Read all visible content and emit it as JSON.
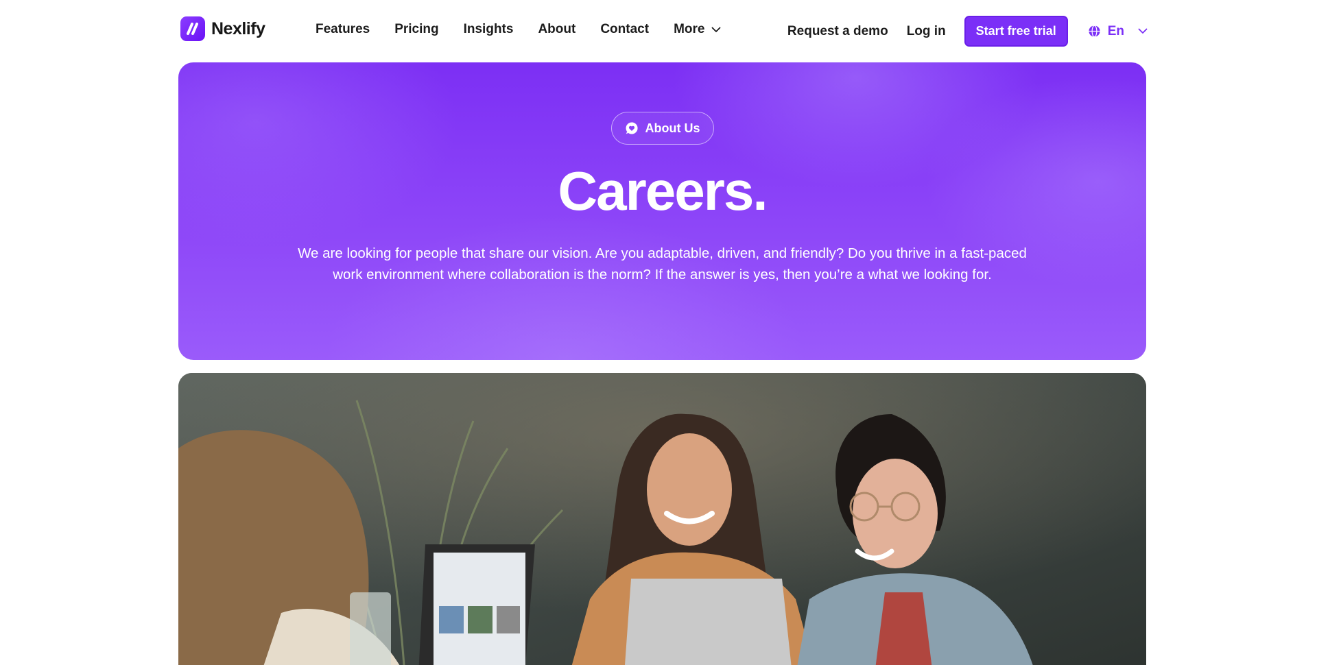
{
  "brand": {
    "name": "Nexlify",
    "accent": "#7b2ff7"
  },
  "nav": {
    "links": [
      "Features",
      "Pricing",
      "Insights",
      "About",
      "Contact"
    ],
    "more_label": "More",
    "request_demo": "Request a demo",
    "login": "Log in",
    "start_trial": "Start free trial",
    "language": "En"
  },
  "hero": {
    "badge_icon": "heart-chat-icon",
    "badge_label": "About Us",
    "title": "Careers.",
    "description": "We are looking for people that share our vision. Are you adaptable, driven, and friendly? Do you thrive in a fast-paced work environment where collaboration is the norm? If the answer is yes, then you’re a what we looking for."
  },
  "photo": {
    "subject": "team-photo"
  }
}
